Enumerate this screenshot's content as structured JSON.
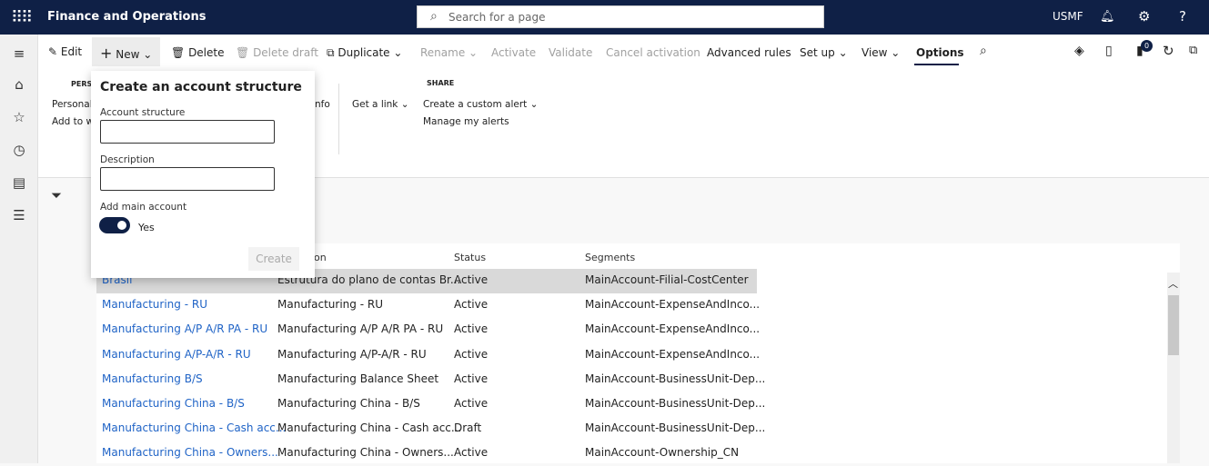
{
  "header": {
    "app_title": "Finance and Operations",
    "search_placeholder": "Search for a page",
    "company": "USMF",
    "help": "?"
  },
  "toolbar": {
    "edit": "Edit",
    "new": "New",
    "delete": "Delete",
    "delete_draft": "Delete draft",
    "duplicate": "Duplicate",
    "rename": "Rename",
    "activate": "Activate",
    "validate": "Validate",
    "cancel_activation": "Cancel activation",
    "advanced_rules": "Advanced rules",
    "set_up": "Set up",
    "view": "View",
    "options": "Options",
    "notification_count": "0"
  },
  "ribbon": {
    "personalize_header": "PERS",
    "personalize": "Personaliz",
    "add_to": "Add to w",
    "info": "nfo",
    "get_link": "Get a link",
    "share_header": "SHARE",
    "custom_alert": "Create a custom alert",
    "manage_alerts": "Manage my alerts"
  },
  "dialog": {
    "title": "Create an account structure",
    "account_structure_label": "Account structure",
    "account_structure_value": "",
    "description_label": "Description",
    "description_value": "",
    "add_main_label": "Add main account",
    "add_main_value": "Yes",
    "add_main_on": true,
    "create": "Create"
  },
  "grid": {
    "headers": [
      "ion",
      "Status",
      "Segments"
    ],
    "rows": [
      [
        "Brasil",
        "Estrutura do plano de contas Br...",
        "Active",
        "MainAccount-Filial-CostCenter"
      ],
      [
        "Manufacturing - RU",
        "Manufacturing - RU",
        "Active",
        "MainAccount-ExpenseAndInco..."
      ],
      [
        "Manufacturing A/P A/R PA - RU",
        "Manufacturing A/P A/R PA - RU",
        "Active",
        "MainAccount-ExpenseAndInco..."
      ],
      [
        "Manufacturing A/P-A/R - RU",
        "Manufacturing A/P-A/R - RU",
        "Active",
        "MainAccount-ExpenseAndInco..."
      ],
      [
        "Manufacturing B/S",
        "Manufacturing Balance Sheet",
        "Active",
        "MainAccount-BusinessUnit-Dep..."
      ],
      [
        "Manufacturing China - B/S",
        "Manufacturing China - B/S",
        "Active",
        "MainAccount-BusinessUnit-Dep..."
      ],
      [
        "Manufacturing China - Cash acc...",
        "Manufacturing China - Cash acc...",
        "Draft",
        "MainAccount-BusinessUnit-Dep..."
      ],
      [
        "Manufacturing China - Owners...",
        "Manufacturing China - Owners...",
        "Active",
        "MainAccount-Ownership_CN"
      ]
    ]
  },
  "colors": {
    "nav": "#0f2046",
    "link": "#1f63c6",
    "selected_row": "#d9d9d9"
  }
}
